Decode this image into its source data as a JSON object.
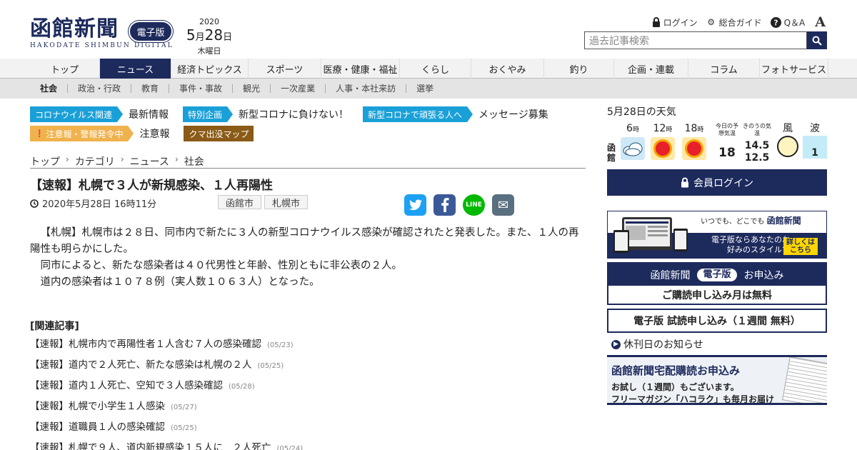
{
  "header": {
    "logo": "函館新聞",
    "logo_sub": "HAKODATE SHIMBUN DIGITAL",
    "edition": "電子版",
    "date": {
      "year": "2020",
      "month": "5",
      "month_suffix": "月",
      "day": "28",
      "day_suffix": "日",
      "weekday": "木曜日"
    },
    "util_links": [
      {
        "label": "ログイン",
        "icon": "lock-icon"
      },
      {
        "label": "総合ガイド",
        "icon": "gear-icon"
      },
      {
        "label": "Q＆A",
        "icon": "question-icon"
      }
    ],
    "font_size_label": "A",
    "search_placeholder": "過去記事検索"
  },
  "main_nav": [
    {
      "label": "トップ",
      "width": 98
    },
    {
      "label": "ニュース",
      "width": 100,
      "active": true
    },
    {
      "label": "経済トピックス",
      "width": 108
    },
    {
      "label": "スポーツ",
      "width": 102
    },
    {
      "label": "医療・健康・福祉",
      "width": 110
    },
    {
      "label": "くらし",
      "width": 100
    },
    {
      "label": "おくやみ",
      "width": 102
    },
    {
      "label": "釣り",
      "width": 98
    },
    {
      "label": "企画・連載",
      "width": 104
    },
    {
      "label": "コラム",
      "width": 100
    },
    {
      "label": "フォトサービス",
      "width": 96
    }
  ],
  "sub_nav": [
    "社会",
    "政治・行政",
    "教育",
    "事件・事故",
    "観光",
    "一次産業",
    "人事・本社来訪",
    "選挙"
  ],
  "topics": {
    "row1": [
      {
        "tag": "コロナウイルス関連",
        "text": "最新情報",
        "style": "blue"
      },
      {
        "tag": "特別企画",
        "text": "新型コロナに負けない！",
        "style": "blue"
      },
      {
        "tag": "新型コロナで頑張る人へ",
        "text": "メッセージ募集",
        "style": "blue"
      }
    ],
    "row2": [
      {
        "tag": "注意報・警報発令中",
        "text": "注意報",
        "style": "orange"
      },
      {
        "tag": "クマ出没マップ",
        "text": "",
        "style": "brown"
      }
    ]
  },
  "breadcrumb": [
    "トップ",
    "カテゴリ",
    "ニュース",
    "社会"
  ],
  "article": {
    "title": "【速報】札幌で３人が新規感染、１人再陽性",
    "datetime": "2020年5月28日 16時11分",
    "regions": [
      "函館市",
      "札幌市"
    ],
    "share": {
      "twitter": "t",
      "facebook": "f",
      "line": "LINE",
      "mail": "✉"
    },
    "paragraphs": [
      "【札幌】札幌市は２８日、同市内で新たに３人の新型コロナウイルス感染が確認されたと発表した。また、１人の再陽性も明らかにした。",
      "同市によると、新たな感染者は４０代男性と年齢、性別ともに非公表の２人。",
      "道内の感染者は１０７８例（実人数１０６３人）となった。"
    ]
  },
  "related": {
    "heading": "[関連記事]",
    "items": [
      {
        "title": "【速報】札幌市内で再陽性者１人含む７人の感染確認",
        "date": "(05/23)"
      },
      {
        "title": "【速報】道内で２人死亡、新たな感染は札幌の２人",
        "date": "(05/25)"
      },
      {
        "title": "【速報】道内１人死亡、空知で３人感染確認",
        "date": "(05/28)"
      },
      {
        "title": "【速報】札幌で小学生１人感染",
        "date": "(05/27)"
      },
      {
        "title": "【速報】道職員１人の感染確認",
        "date": "(05/25)"
      },
      {
        "title": "【速報】札幌で９人、道内新規感染１５人に　２人死亡",
        "date": "(05/24)"
      }
    ]
  },
  "weather": {
    "title": "5月28日の天気",
    "city": "函館",
    "times": [
      {
        "hour": "6",
        "unit": "時",
        "icon": "cloudy-icon"
      },
      {
        "hour": "12",
        "unit": "時",
        "icon": "sunny-icon"
      },
      {
        "hour": "18",
        "unit": "時",
        "icon": "sunny-icon"
      }
    ],
    "forecast_label": "今日の予想気温",
    "forecast_temp": "18",
    "yesterday_label": "きのうの気温",
    "yesterday_high": "14.5",
    "yesterday_low": "12.5",
    "wind_label": "風",
    "wave_label": "波",
    "wave_value": "1"
  },
  "sidebar": {
    "login": "会員ログイン",
    "promo_top": "いつでも、どこでも",
    "promo_logo": "函館新聞",
    "promo_text": "電子版ならあなたのお好みのスタイルで",
    "promo_cta": "詳しくはこちら",
    "subscribe_left": "函館新聞",
    "subscribe_pill": "電子版",
    "subscribe_right": "お申込み",
    "subscribe_bottom": "ご購読申し込み月は無料",
    "trial": "電子版 試読申し込み（１週間 無料）",
    "holiday": "休刊日のお知らせ",
    "delivery_title": "函館新聞宅配購読お申込み",
    "delivery_line1": "お試し（１週間）もございます。",
    "delivery_line2": "フリーマガジン「ハコラク」も毎月お届け"
  },
  "colors": {
    "navy": "#1d2a5c",
    "tag_blue": "#1aa0d8",
    "tag_orange": "#f0b24d",
    "tag_brown": "#8a5a16"
  }
}
